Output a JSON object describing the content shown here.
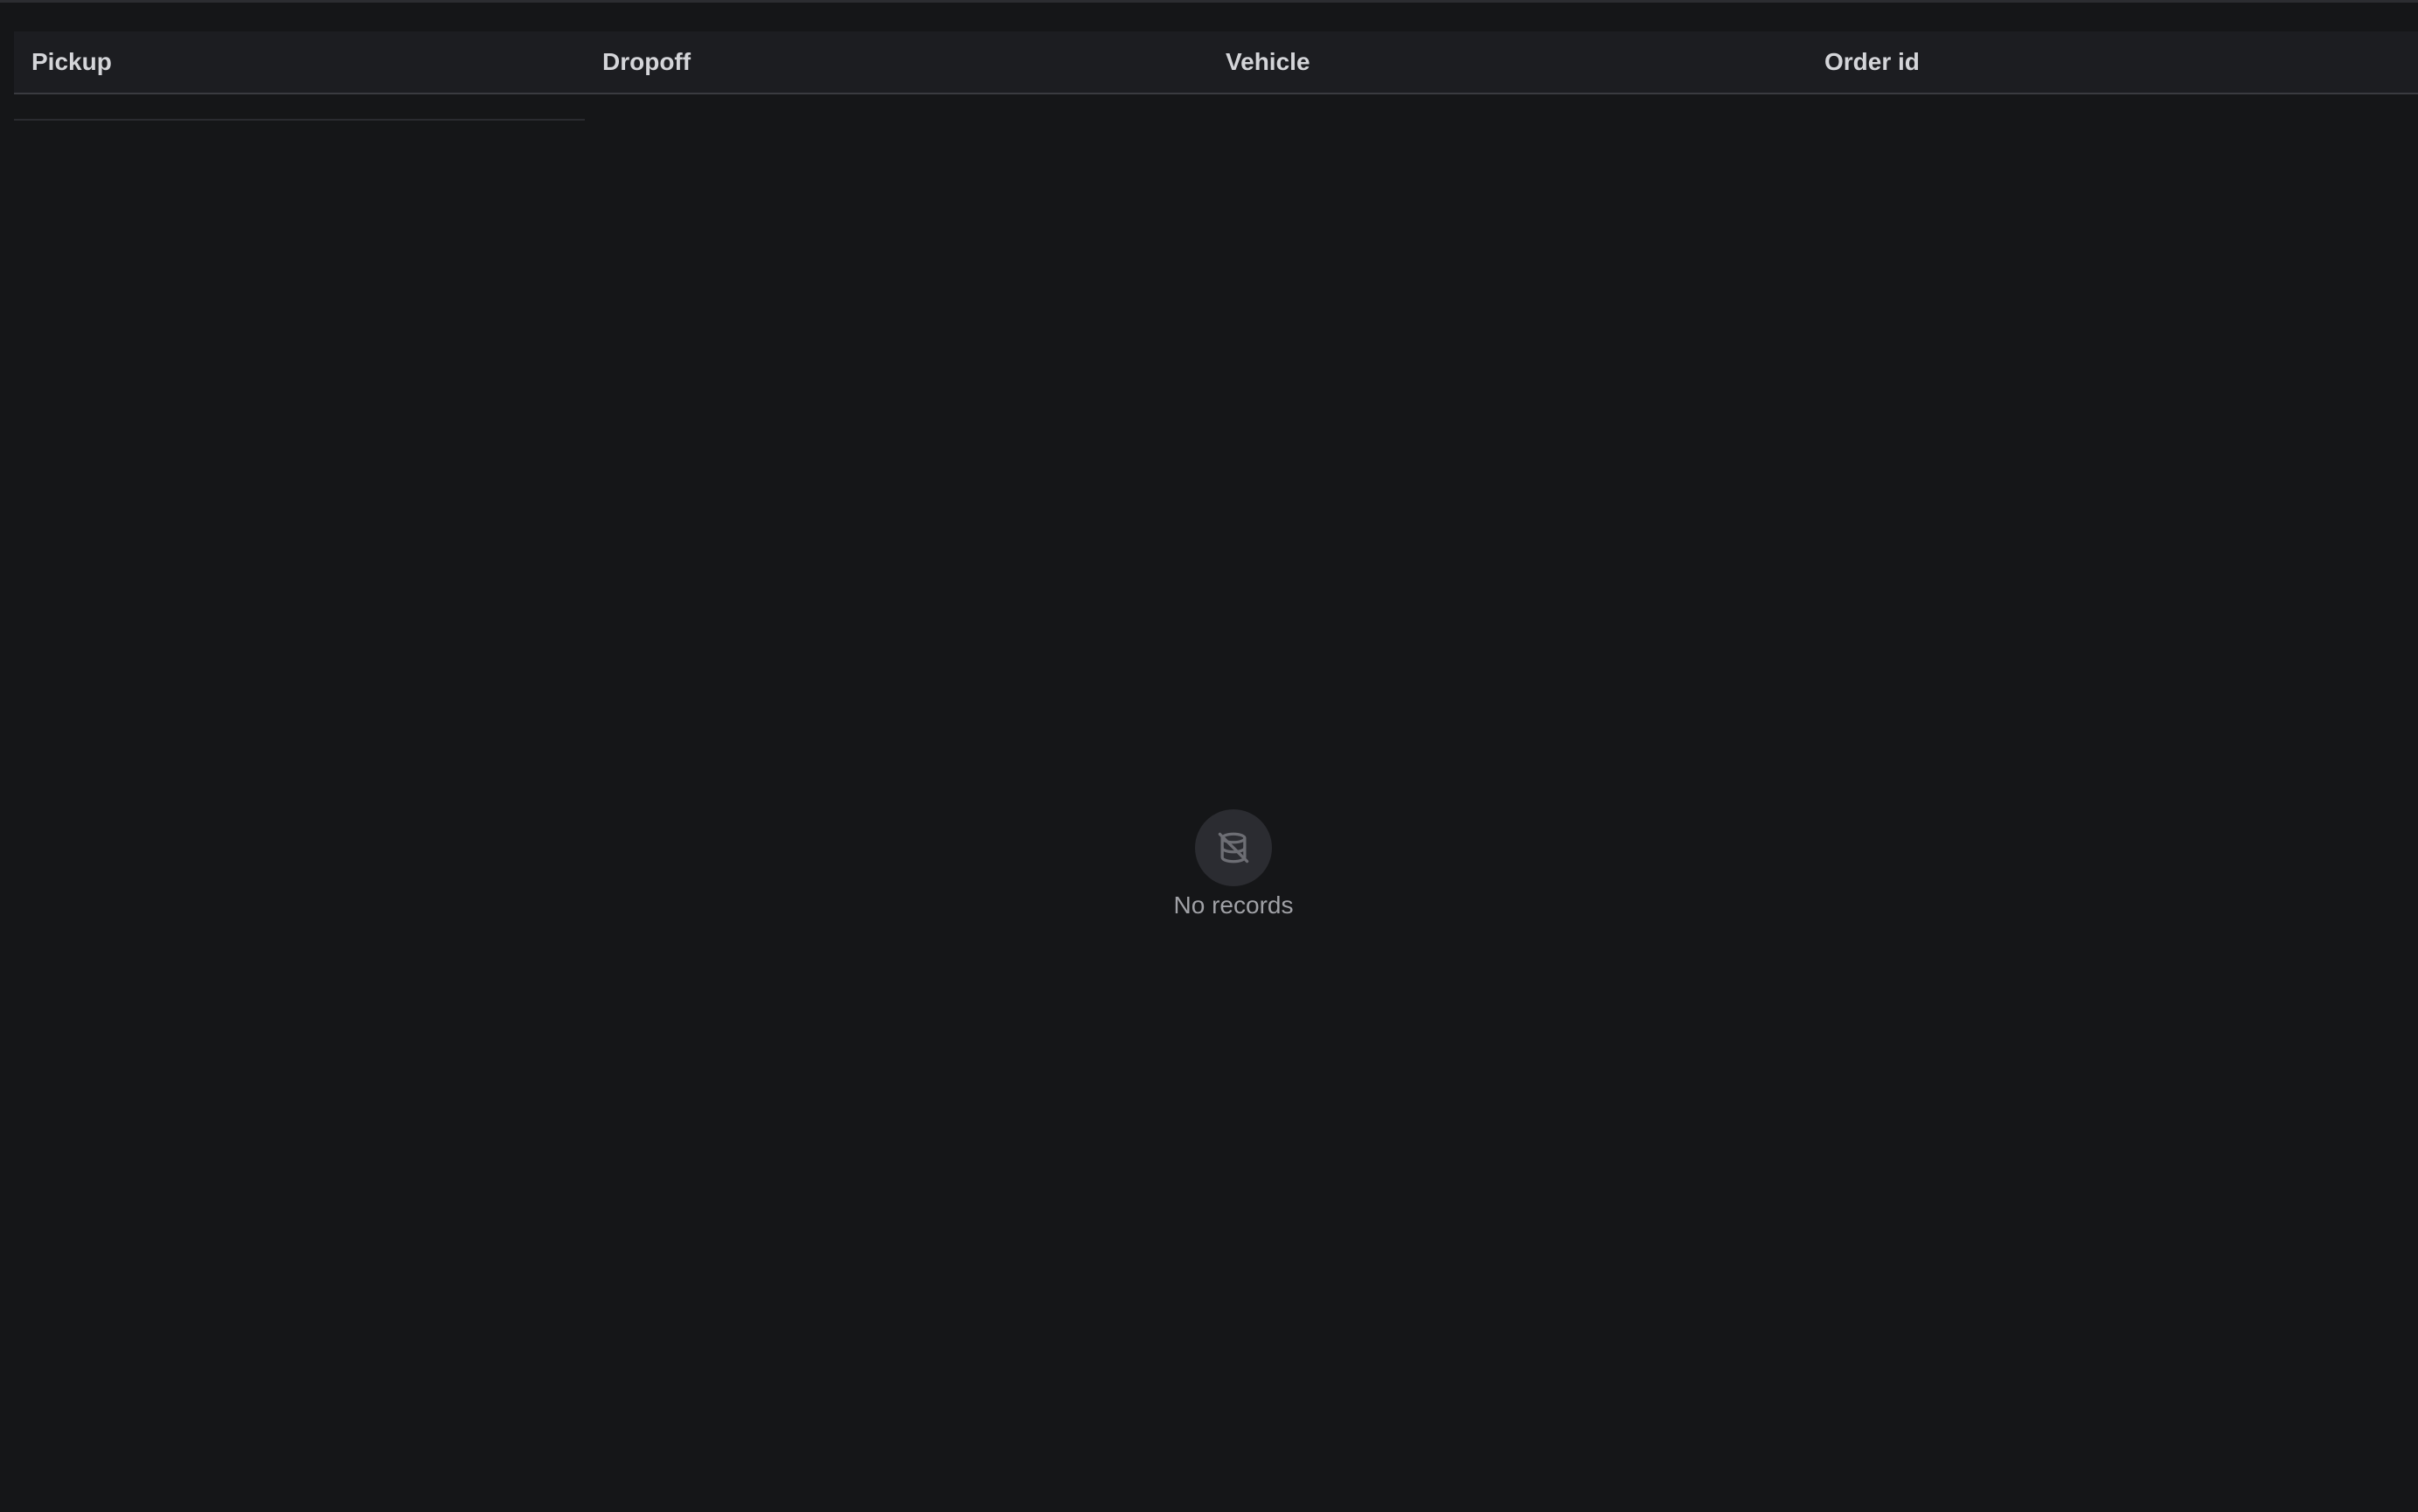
{
  "table": {
    "columns": [
      {
        "label": "Pickup"
      },
      {
        "label": "Dropoff"
      },
      {
        "label": "Vehicle"
      },
      {
        "label": "Order id"
      }
    ],
    "rows": []
  },
  "empty_state": {
    "icon": "database-off-icon",
    "message": "No records"
  },
  "colors": {
    "background": "#151618",
    "header_background": "#1c1d21",
    "header_text": "#d4d5d9",
    "muted_text": "#a0a1a6",
    "icon_circle": "#2b2c31"
  }
}
